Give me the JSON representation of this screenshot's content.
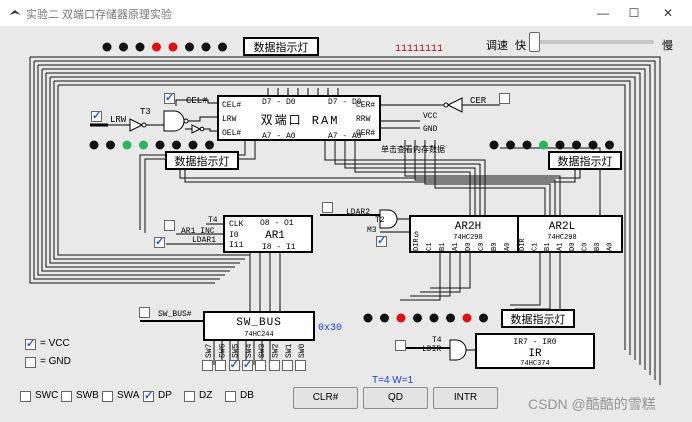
{
  "window": {
    "title": "实验二 双端口存储器原理实验"
  },
  "speed": {
    "label": "调速",
    "fast": "快",
    "slow": "慢",
    "level": 0.0
  },
  "top_value": "11111111",
  "displays": {
    "top_left": "数据指示灯",
    "mid_left": "数据指示灯",
    "right": "数据指示灯",
    "bottom_right": "数据指示灯"
  },
  "lights": {
    "top_left": [
      "#111",
      "#111",
      "#111",
      "#e01010",
      "#e01010",
      "#111",
      "#111",
      "#111"
    ],
    "mid_left": [
      "#111",
      "#111",
      "#2bb55e",
      "#2bb55e",
      "#111",
      "#111",
      "#111",
      "#111"
    ],
    "right": [
      "#111",
      "#111",
      "#111",
      "#2bb55e",
      "#111",
      "#111",
      "#111",
      "#111"
    ],
    "bottom_right": [
      "#111",
      "#111",
      "#e01010",
      "#111",
      "#111",
      "#111",
      "#e01010",
      "#111"
    ]
  },
  "ram": {
    "title": "双端口 RAM",
    "hint": "单击查看内存数据",
    "top_left_bus": "D7 - D0",
    "top_right_bus": "D7 - D0",
    "bot_left_bus": "A7 - A0",
    "bot_right_bus": "A7 - A0",
    "pins_left": [
      "CEL#",
      "LRW",
      "OEL#"
    ],
    "pins_right": [
      "CER#",
      "RRW",
      "OER#"
    ]
  },
  "signals": {
    "cel": "CEL#",
    "lrw": "LRW",
    "t3": "T3",
    "cer": "CER",
    "vcc": "VCC",
    "gnd": "GND"
  },
  "ar1": {
    "name": "AR1",
    "chip": "",
    "top": "O8 - O1",
    "bot": "I8 - I1",
    "pins": [
      "CLK",
      "I0",
      "I11"
    ],
    "t4": "T4",
    "inc": "AR1_INC",
    "load": "LDAR1"
  },
  "ar2h": {
    "name": "AR2H",
    "chip": "74HC298",
    "pin": "S",
    "pins": [
      "DIR",
      "C1",
      "B1",
      "A1",
      "D0",
      "C0",
      "B0",
      "A0"
    ]
  },
  "ar2l": {
    "name": "AR2L",
    "chip": "74HC298",
    "pins": [
      "DIR",
      "C1",
      "B1",
      "A1",
      "D0",
      "C0",
      "B0",
      "A0"
    ]
  },
  "ldar2": {
    "label": "LDAR2",
    "t2": "T2",
    "m3": "M3"
  },
  "sw_bus": {
    "name": "SW_BUS",
    "chip": "74HC244",
    "label": "SW_BUS#",
    "value": "0x30",
    "switches": [
      "SW7",
      "SW6",
      "SW5",
      "SW4",
      "SW3",
      "SW2",
      "SW1",
      "SW0"
    ],
    "switch_states": [
      false,
      false,
      true,
      true,
      false,
      false,
      false,
      false
    ]
  },
  "ir": {
    "name": "IR",
    "chip": "74HC374",
    "bus": "IR7 - IR0",
    "t4": "T4",
    "load": "LDIR"
  },
  "legend": {
    "vcc": "= VCC",
    "gnd": "= GND"
  },
  "bottom_checks": [
    {
      "label": "SWC",
      "checked": false
    },
    {
      "label": "SWB",
      "checked": false
    },
    {
      "label": "SWA",
      "checked": false
    },
    {
      "label": "DP",
      "checked": true
    },
    {
      "label": "DZ",
      "checked": false
    },
    {
      "label": "DB",
      "checked": false
    }
  ],
  "status": "T=4 W=1",
  "buttons": {
    "clr": "CLR#",
    "qd": "QD",
    "intr": "INTR"
  },
  "watermark": "CSDN @酷酷的雪糕"
}
